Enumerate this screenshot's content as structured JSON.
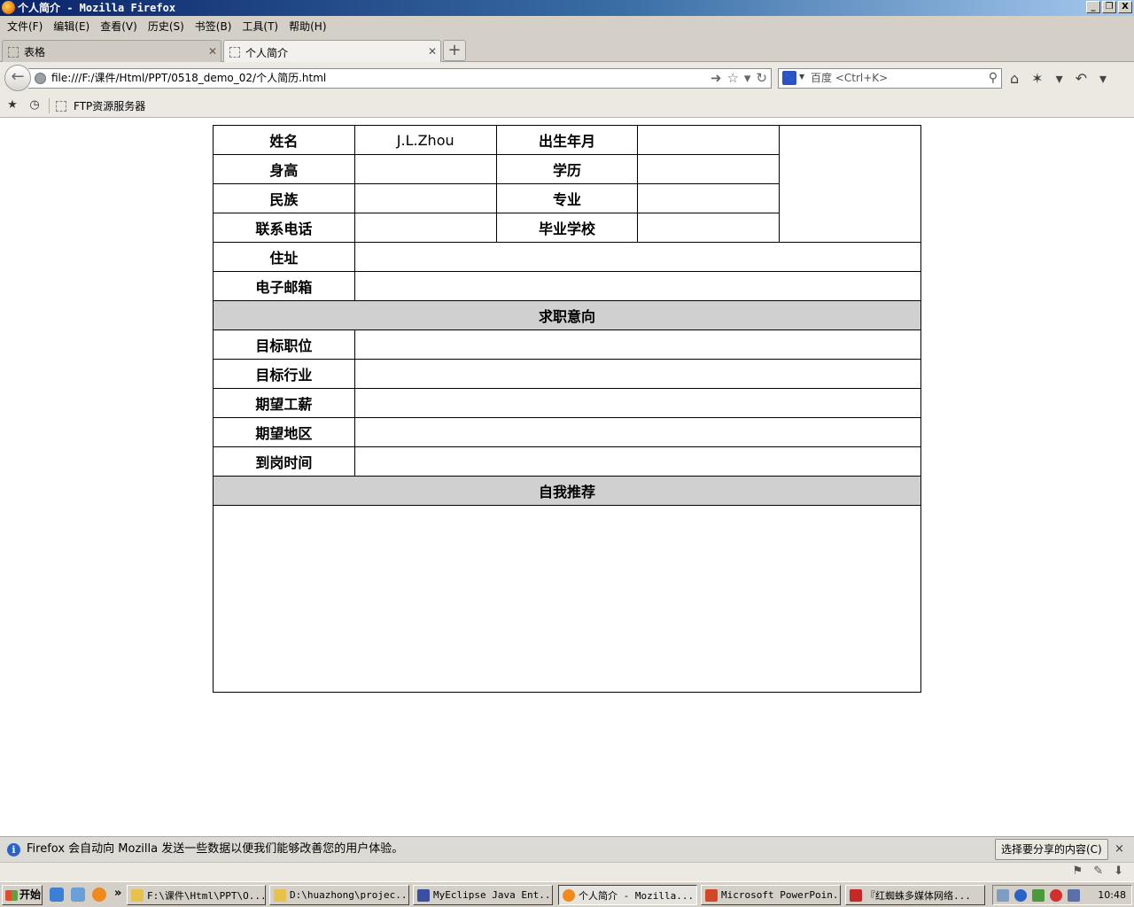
{
  "window": {
    "title": "个人简介 - Mozilla Firefox",
    "buttons": [
      "_",
      "❐",
      "X"
    ]
  },
  "menu": [
    "文件(F)",
    "编辑(E)",
    "查看(V)",
    "历史(S)",
    "书签(B)",
    "工具(T)",
    "帮助(H)"
  ],
  "tabs": [
    {
      "label": "表格",
      "active": false
    },
    {
      "label": "个人简介",
      "active": true
    }
  ],
  "new_tab_label": "+",
  "nav": {
    "url": "file:///F:/课件/Html/PPT/0518_demo_02/个人简历.html",
    "search_placeholder": "百度 <Ctrl+K>",
    "search_engine_icon": "baidu-paw-icon"
  },
  "bookmarks": {
    "items": [
      {
        "label": "FTP资源服务器"
      }
    ]
  },
  "resume": {
    "basic": {
      "name_label": "姓名",
      "name_value": "J.L.Zhou",
      "birth_label": "出生年月",
      "birth_value": "",
      "height_label": "身高",
      "height_value": "",
      "education_label": "学历",
      "education_value": "",
      "ethnicity_label": "民族",
      "ethnicity_value": "",
      "major_label": "专业",
      "major_value": "",
      "phone_label": "联系电话",
      "phone_value": "",
      "school_label": "毕业学校",
      "school_value": "",
      "address_label": "住址",
      "address_value": "",
      "email_label": "电子邮箱",
      "email_value": ""
    },
    "intention": {
      "header": "求职意向",
      "rows": [
        {
          "label": "目标职位",
          "value": ""
        },
        {
          "label": "目标行业",
          "value": ""
        },
        {
          "label": "期望工薪",
          "value": ""
        },
        {
          "label": "期望地区",
          "value": ""
        },
        {
          "label": "到岗时间",
          "value": ""
        }
      ]
    },
    "self_intro": {
      "header": "自我推荐",
      "value": ""
    },
    "section_color": "#d0d0d0"
  },
  "notification": {
    "message": "Firefox 会自动向 Mozilla 发送一些数据以便我们能够改善您的用户体验。",
    "share_button": "选择要分享的内容(C)",
    "close": "×"
  },
  "taskbar": {
    "start": "开始",
    "overflow": "»",
    "tasks": [
      {
        "label": "F:\\课件\\Html\\PPT\\O...",
        "active": false,
        "color": "#e8c14a"
      },
      {
        "label": "D:\\huazhong\\projec...",
        "active": false,
        "color": "#e8c14a"
      },
      {
        "label": "MyEclipse Java Ent...",
        "active": false,
        "color": "#3a4fa0"
      },
      {
        "label": "个人简介 - Mozilla...",
        "active": true,
        "color": "#f08a1c"
      },
      {
        "label": "Microsoft PowerPoin...",
        "active": false,
        "color": "#d24726"
      },
      {
        "label": "『红蜘蛛多媒体网络...",
        "active": false,
        "color": "#c62828"
      }
    ],
    "clock": "10:48"
  }
}
